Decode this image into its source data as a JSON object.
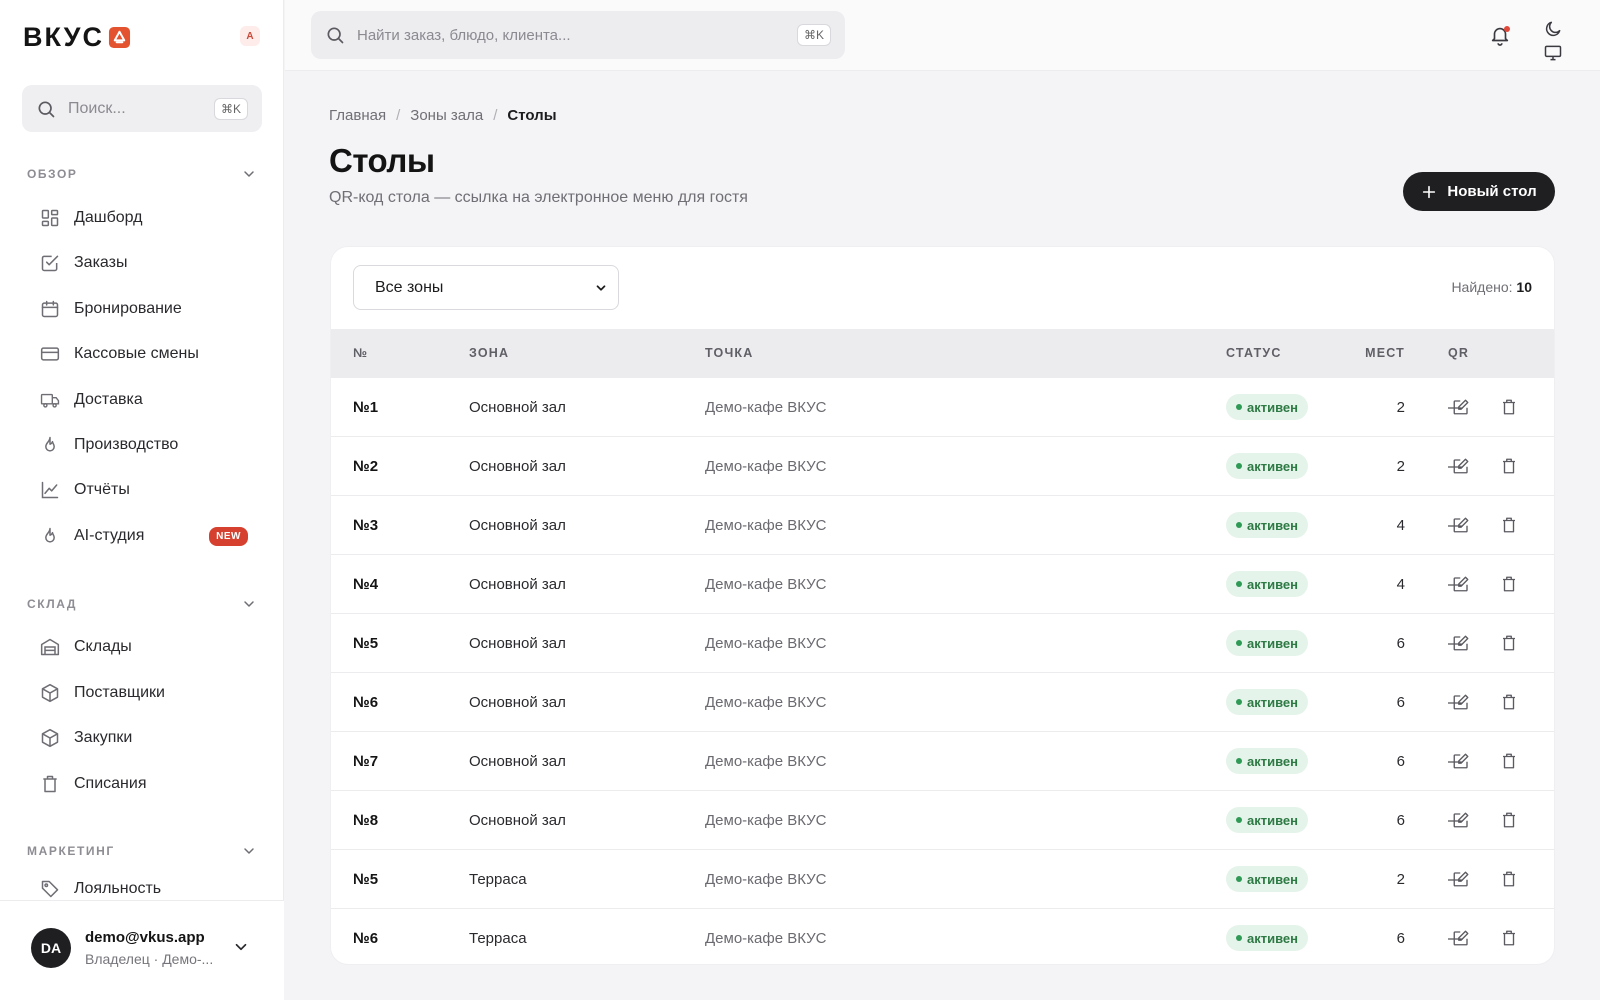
{
  "brand": {
    "name": "ВКУС",
    "lang_badge": "A"
  },
  "sidebar": {
    "search_placeholder": "Поиск...",
    "search_shortcut": "⌘K",
    "sections": {
      "overview": "ОБЗОР",
      "warehouse": "СКЛАД",
      "marketing": "МАРКЕТИНГ"
    },
    "overview_items": [
      {
        "label": "Дашборд",
        "icon": "dashboard-icon"
      },
      {
        "label": "Заказы",
        "icon": "checkbox-icon"
      },
      {
        "label": "Бронирование",
        "icon": "calendar-icon"
      },
      {
        "label": "Кассовые смены",
        "icon": "card-icon"
      },
      {
        "label": "Доставка",
        "icon": "truck-icon"
      },
      {
        "label": "Производство",
        "icon": "flame-icon"
      },
      {
        "label": "Отчёты",
        "icon": "chart-icon"
      },
      {
        "label": "AI-студия",
        "icon": "flame-icon",
        "badge": "NEW"
      }
    ],
    "warehouse_items": [
      {
        "label": "Склады",
        "icon": "warehouse-icon"
      },
      {
        "label": "Поставщики",
        "icon": "box-icon"
      },
      {
        "label": "Закупки",
        "icon": "box-icon"
      },
      {
        "label": "Списания",
        "icon": "trash-icon"
      }
    ],
    "marketing_items": [
      {
        "label": "Лояльность",
        "icon": "tag-icon"
      }
    ],
    "user": {
      "initials": "DA",
      "email": "demo@vkus.app",
      "role": "Владелец · Демо-..."
    }
  },
  "topbar": {
    "search_placeholder": "Найти заказ, блюдо, клиента...",
    "search_shortcut": "⌘K"
  },
  "breadcrumb": {
    "home": "Главная",
    "zones": "Зоны зала",
    "current": "Столы"
  },
  "page": {
    "title": "Столы",
    "subtitle": "QR-код стола — ссылка на электронное меню для гостя",
    "new_button": "Новый стол"
  },
  "filter": {
    "selected": "Все зоны",
    "found_label": "Найдено:",
    "found_count": "10"
  },
  "table": {
    "columns": {
      "num": "№",
      "zone": "ЗОНА",
      "point": "ТОЧКА",
      "seats": "МЕСТ",
      "qr": "QR",
      "status": "СТАТУС"
    },
    "rows": [
      {
        "num": "№1",
        "zone": "Основной зал",
        "point": "Демо-кафе ВКУС",
        "seats": "2",
        "qr": "—",
        "status": "активен"
      },
      {
        "num": "№2",
        "zone": "Основной зал",
        "point": "Демо-кафе ВКУС",
        "seats": "2",
        "qr": "—",
        "status": "активен"
      },
      {
        "num": "№3",
        "zone": "Основной зал",
        "point": "Демо-кафе ВКУС",
        "seats": "4",
        "qr": "—",
        "status": "активен"
      },
      {
        "num": "№4",
        "zone": "Основной зал",
        "point": "Демо-кафе ВКУС",
        "seats": "4",
        "qr": "—",
        "status": "активен"
      },
      {
        "num": "№5",
        "zone": "Основной зал",
        "point": "Демо-кафе ВКУС",
        "seats": "6",
        "qr": "—",
        "status": "активен"
      },
      {
        "num": "№6",
        "zone": "Основной зал",
        "point": "Демо-кафе ВКУС",
        "seats": "6",
        "qr": "—",
        "status": "активен"
      },
      {
        "num": "№7",
        "zone": "Основной зал",
        "point": "Демо-кафе ВКУС",
        "seats": "6",
        "qr": "—",
        "status": "активен"
      },
      {
        "num": "№8",
        "zone": "Основной зал",
        "point": "Демо-кафе ВКУС",
        "seats": "6",
        "qr": "—",
        "status": "активен"
      },
      {
        "num": "№5",
        "zone": "Терраса",
        "point": "Демо-кафе ВКУС",
        "seats": "2",
        "qr": "—",
        "status": "активен"
      },
      {
        "num": "№6",
        "zone": "Терраса",
        "point": "Демо-кафе ВКУС",
        "seats": "6",
        "qr": "—",
        "status": "активен"
      }
    ]
  },
  "colors": {
    "brand_accent": "#e4532f",
    "status_active_bg": "#e5f4ea",
    "status_active_text": "#2e7a45",
    "new_badge": "#d6412f",
    "primary_button": "#1f1f22"
  }
}
